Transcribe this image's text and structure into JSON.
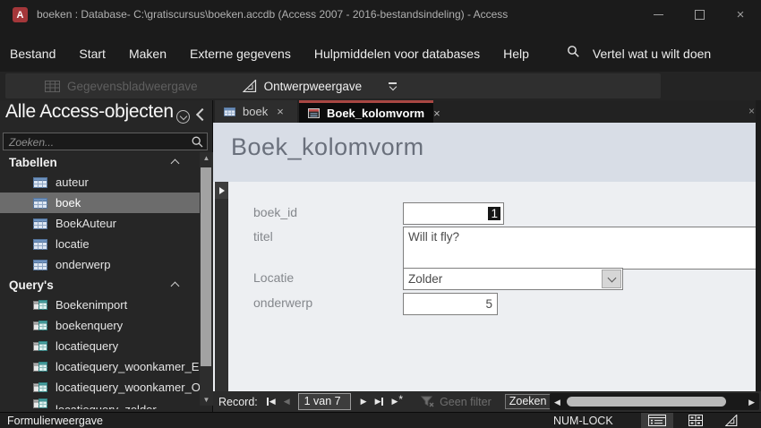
{
  "window": {
    "app_label": "A",
    "title": "boeken : Database- C:\\gratiscursus\\boeken.accdb (Access 2007 - 2016-bestandsindeling)  -  Access"
  },
  "menu": {
    "items": [
      "Bestand",
      "Start",
      "Maken",
      "Externe gegevens",
      "Hulpmiddelen voor databases",
      "Help"
    ],
    "tell_me": "Vertel wat u wilt doen"
  },
  "toolbar": {
    "datasheet_view": "Gegevensbladweergave",
    "design_view": "Ontwerpweergave"
  },
  "sidebar": {
    "title": "Alle Access-objecten",
    "search_placeholder": "Zoeken...",
    "selected_item": "boek",
    "groups": [
      {
        "label": "Tabellen",
        "items": [
          {
            "name": "auteur"
          },
          {
            "name": "boek"
          },
          {
            "name": "BoekAuteur"
          },
          {
            "name": "locatie"
          },
          {
            "name": "onderwerp"
          }
        ]
      },
      {
        "label": "Query's",
        "items": [
          {
            "name": "Boekenimport"
          },
          {
            "name": "boekenquery"
          },
          {
            "name": "locatiequery"
          },
          {
            "name": "locatiequery_woonkamer_EN"
          },
          {
            "name": "locatiequery_woonkamer_OF"
          },
          {
            "name": "locatiequery_zolder"
          }
        ]
      }
    ]
  },
  "document": {
    "tabs": [
      {
        "label": "boek"
      },
      {
        "label": "Boek_kolomvorm"
      }
    ],
    "active_tab": "Boek_kolomvorm",
    "form": {
      "title": "Boek_kolomvorm",
      "fields": [
        {
          "label": "boek_id",
          "value": "1"
        },
        {
          "label": "titel",
          "value": "Will it fly?"
        },
        {
          "label": "Locatie",
          "value": "Zolder"
        },
        {
          "label": "onderwerp",
          "value": "5"
        }
      ]
    },
    "record_bar": {
      "label": "Record:",
      "position": "1 van 7",
      "no_filter": "Geen filter",
      "search_box": "Zoeken"
    }
  },
  "status_bar": {
    "view_mode": "Formulierweergave",
    "keyboard_state": "NUM-LOCK"
  },
  "icons": {
    "close": "×",
    "triangle_left": "◀",
    "triangle_right": "▶",
    "triangle_up": "▲",
    "triangle_down": "▼",
    "asterisk": "*"
  },
  "colors": {
    "access_red": "#a4373a",
    "active_tab_accent": "#a84743",
    "form_header_bg": "#d8dde6",
    "form_body_bg": "#edeff2",
    "sidebar_selected_bg": "#6c6c6c"
  }
}
